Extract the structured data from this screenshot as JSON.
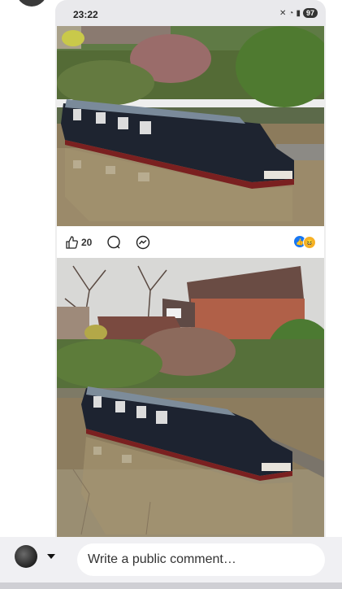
{
  "status_bar": {
    "time": "23:22",
    "battery": "97",
    "icons": [
      "mute-icon",
      "wifi-icon",
      "signal-icon",
      "battery-icon"
    ]
  },
  "post": {
    "like_count": "20",
    "actions": [
      "like-icon",
      "comment-icon",
      "messenger-icon"
    ],
    "reactions": [
      "like-reaction-icon",
      "haha-reaction-icon"
    ]
  },
  "comment_bar": {
    "placeholder": "Write a public comment…"
  },
  "colors": {
    "like_blue": "#1877f2",
    "haha_yellow": "#f7b125"
  }
}
